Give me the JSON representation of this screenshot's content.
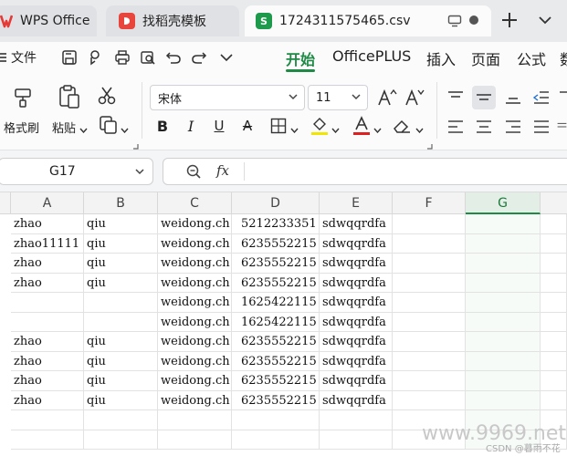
{
  "tabs": [
    {
      "label": "WPS Office",
      "icon": "wps-logo-icon"
    },
    {
      "label": "找稻壳模板",
      "icon": "docer-icon"
    },
    {
      "label": "1724311575465.csv",
      "icon": "spreadsheet-s-icon",
      "active": true
    }
  ],
  "menu": {
    "file": "文件",
    "tabs": [
      "开始",
      "OfficePLUS",
      "插入",
      "页面",
      "公式",
      "数"
    ],
    "active_tab": "开始"
  },
  "ribbon": {
    "format_painter": "格式刷",
    "paste": "粘贴",
    "font_name": "宋体",
    "font_size": "11"
  },
  "formula_bar": {
    "name_box": "G17",
    "zoom_icon": "zoom-icon",
    "fx": "fx",
    "formula": ""
  },
  "sheet": {
    "columns": [
      "A",
      "B",
      "C",
      "D",
      "E",
      "F",
      "G"
    ],
    "selected_column": "G",
    "rows": [
      [
        "zhao",
        "qiu",
        "weidong.ch",
        "5212233351",
        "sdwqqrdfa",
        "",
        ""
      ],
      [
        "zhao11111",
        "qiu",
        "weidong.ch",
        "6235552215",
        "sdwqqrdfa",
        "",
        ""
      ],
      [
        "zhao",
        "qiu",
        "weidong.ch",
        "6235552215",
        "sdwqqrdfa",
        "",
        ""
      ],
      [
        "zhao",
        "qiu",
        "weidong.ch",
        "6235552215",
        "sdwqqrdfa",
        "",
        ""
      ],
      [
        "",
        "",
        "weidong.ch",
        "1625422115",
        "sdwqqrdfa",
        "",
        ""
      ],
      [
        "",
        "",
        "weidong.ch",
        "1625422115",
        "sdwqqrdfa",
        "",
        ""
      ],
      [
        "zhao",
        "qiu",
        "weidong.ch",
        "6235552215",
        "sdwqqrdfa",
        "",
        ""
      ],
      [
        "zhao",
        "qiu",
        "weidong.ch",
        "6235552215",
        "sdwqqrdfa",
        "",
        ""
      ],
      [
        "zhao",
        "qiu",
        "weidong.ch",
        "6235552215",
        "sdwqqrdfa",
        "",
        ""
      ],
      [
        "zhao",
        "qiu",
        "weidong.ch",
        "6235552215",
        "sdwqqrdfa",
        "",
        ""
      ],
      [
        "",
        "",
        "",
        "",
        "",
        "",
        ""
      ],
      [
        "",
        "",
        "",
        "",
        "",
        "",
        ""
      ]
    ]
  },
  "watermark": {
    "site": "www.9969.net",
    "credit": "CSDN @暮雨不花"
  },
  "colors": {
    "accent_green": "#1f8a45",
    "tab_s_icon": "#1e9a4c",
    "docer_icon": "#e8453c",
    "wps_logo": "#e53935"
  }
}
